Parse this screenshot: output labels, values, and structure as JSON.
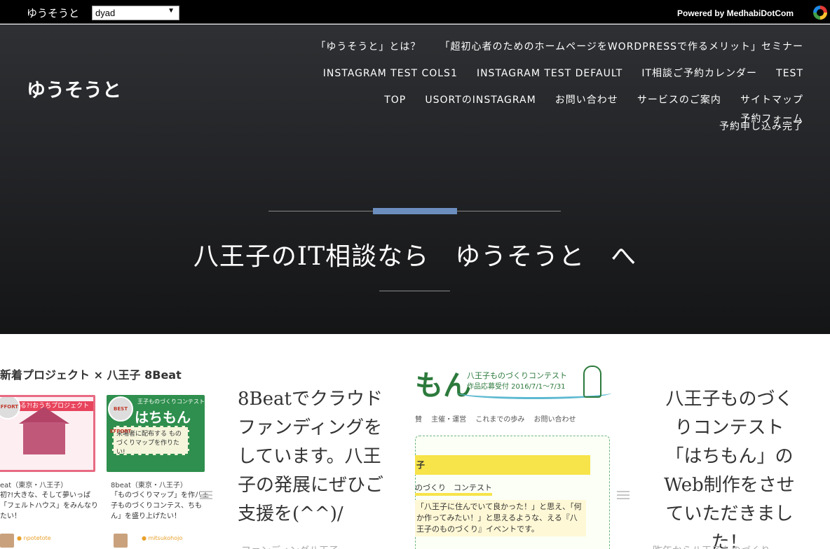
{
  "topbar": {
    "site_name": "ゆうそうと",
    "select_value": "dyad",
    "powered_by": "Powered by MedhabiDotCom"
  },
  "hero": {
    "site_title": "ゆうそうと",
    "nav_rows": [
      [
        "「ゆうそうと」とは？",
        "「超初心者のためのホームページをWORDPRESSで作るメリット」セミナー"
      ],
      [
        "INSTAGRAM TEST COLS1",
        "INSTAGRAM TEST DEFAULT",
        "IT相談ご予約カレンダー",
        "TEST"
      ],
      [
        "TOP",
        "USORTのINSTAGRAM",
        "お問い合わせ",
        "サービスのご案内",
        "サイトマップ",
        "予約フォーム"
      ],
      [
        "予約申し込み完了"
      ]
    ],
    "headline": "八王子のIT相談なら　ゆうそうと　へ"
  },
  "card1": {
    "title": "新着プロジェクト × 八王子 8Beat",
    "thumb_a_band": "つくる?!おうちプロジェクト",
    "thumb_b_title": "はちもん",
    "thumb_b_sub": "王子ものづくりコンテスト",
    "thumb_b_box": "来場者に配布する ものづくりマップを作りたい!",
    "badge_b": "BEST EFFORT",
    "badge_a": "EFFORT",
    "items": [
      {
        "category": "eat（東京・八王子）",
        "desc": "初?!大きな、そして夢いっぱ「フェルトハウス」をみんなりたい！",
        "author": "npotetote"
      },
      {
        "category": "8beat（東京・八王子）",
        "desc": "「ものづくりマップ」を作八王子ものづくりコンテス、ちもん」を盛り上げたい！",
        "author": "mitsukohojo"
      }
    ]
  },
  "text1": "8Beatでクラウドファンディングをしています。八王子の発展にぜひご支援を(^^)/",
  "text1_below": "ファンディング八王子",
  "card2": {
    "title": "もん",
    "sub1": "八王子ものづくりコンテスト",
    "sub2": "作品応募受付 2016/7/1〜7/31",
    "nav": "賛 主催・運営 これまでの歩み お問い合わせ",
    "ribbon": "子",
    "label": "のづくり　コンテスト",
    "body": "「八王子に住んでいて良かった！」と思え、「何か作ってみたい！」と思えるような、える『八王子のものづくり』イベントです。"
  },
  "text2": "八王子ものづくりコンテスト「はちもん」のWeb制作をさせていただきました！",
  "text2_below": "昨年から八王子ものづくり"
}
